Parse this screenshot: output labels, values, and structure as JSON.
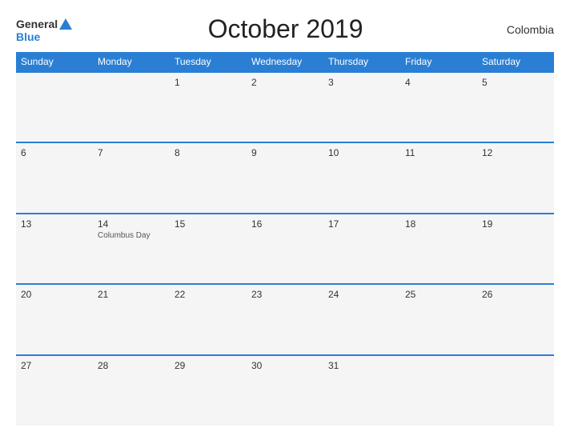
{
  "header": {
    "logo_general": "General",
    "logo_blue": "Blue",
    "title": "October 2019",
    "country": "Colombia"
  },
  "calendar": {
    "days_of_week": [
      "Sunday",
      "Monday",
      "Tuesday",
      "Wednesday",
      "Thursday",
      "Friday",
      "Saturday"
    ],
    "weeks": [
      [
        {
          "date": "",
          "event": ""
        },
        {
          "date": "",
          "event": ""
        },
        {
          "date": "1",
          "event": ""
        },
        {
          "date": "2",
          "event": ""
        },
        {
          "date": "3",
          "event": ""
        },
        {
          "date": "4",
          "event": ""
        },
        {
          "date": "5",
          "event": ""
        }
      ],
      [
        {
          "date": "6",
          "event": ""
        },
        {
          "date": "7",
          "event": ""
        },
        {
          "date": "8",
          "event": ""
        },
        {
          "date": "9",
          "event": ""
        },
        {
          "date": "10",
          "event": ""
        },
        {
          "date": "11",
          "event": ""
        },
        {
          "date": "12",
          "event": ""
        }
      ],
      [
        {
          "date": "13",
          "event": ""
        },
        {
          "date": "14",
          "event": "Columbus Day"
        },
        {
          "date": "15",
          "event": ""
        },
        {
          "date": "16",
          "event": ""
        },
        {
          "date": "17",
          "event": ""
        },
        {
          "date": "18",
          "event": ""
        },
        {
          "date": "19",
          "event": ""
        }
      ],
      [
        {
          "date": "20",
          "event": ""
        },
        {
          "date": "21",
          "event": ""
        },
        {
          "date": "22",
          "event": ""
        },
        {
          "date": "23",
          "event": ""
        },
        {
          "date": "24",
          "event": ""
        },
        {
          "date": "25",
          "event": ""
        },
        {
          "date": "26",
          "event": ""
        }
      ],
      [
        {
          "date": "27",
          "event": ""
        },
        {
          "date": "28",
          "event": ""
        },
        {
          "date": "29",
          "event": ""
        },
        {
          "date": "30",
          "event": ""
        },
        {
          "date": "31",
          "event": ""
        },
        {
          "date": "",
          "event": ""
        },
        {
          "date": "",
          "event": ""
        }
      ]
    ]
  }
}
